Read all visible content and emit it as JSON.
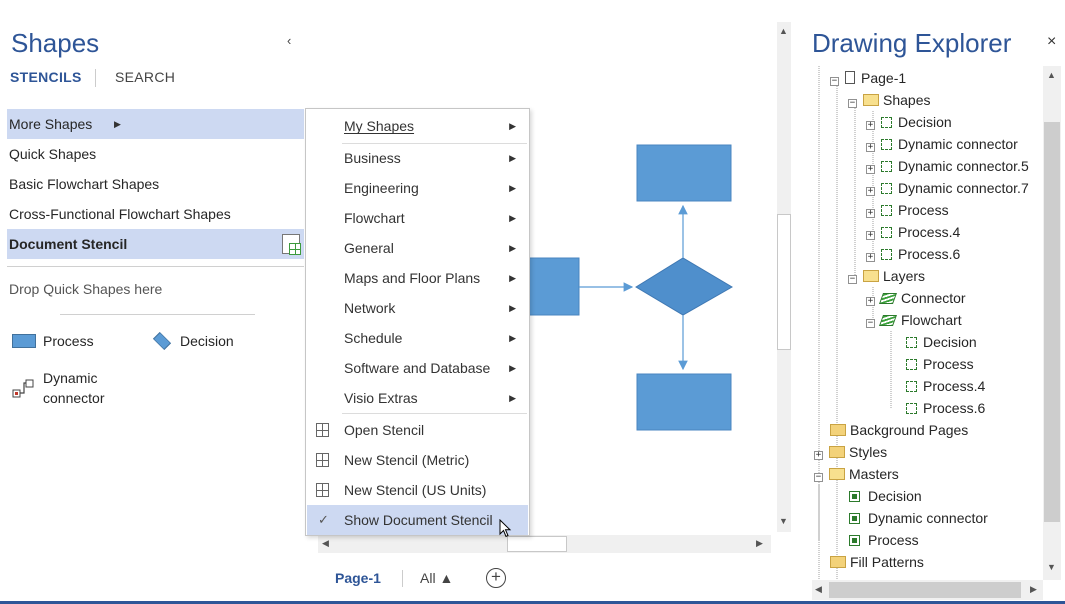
{
  "shapes_pane": {
    "title": "Shapes",
    "collapse_glyph": "‹",
    "tabs": {
      "stencils": "STENCILS",
      "search": "SEARCH"
    },
    "stencils": [
      {
        "label": "More Shapes",
        "highlighted": true,
        "has_submenu": true
      },
      {
        "label": "Quick Shapes"
      },
      {
        "label": "Basic Flowchart Shapes"
      },
      {
        "label": "Cross-Functional Flowchart Shapes"
      },
      {
        "label": "Document Stencil",
        "highlighted": true,
        "bold": true
      }
    ],
    "drop_text": "Drop Quick Shapes here",
    "masters": [
      {
        "label": "Process",
        "icon": "process-rect-icon"
      },
      {
        "label": "Decision",
        "icon": "decision-diamond-icon"
      },
      {
        "label": "Dynamic\nconnector",
        "line1": "Dynamic",
        "line2": "connector",
        "icon": "dynamic-connector-icon"
      }
    ]
  },
  "context_menu": {
    "groups": [
      [
        {
          "label": "My Shapes",
          "submenu": true
        }
      ],
      [
        {
          "label": "Business",
          "submenu": true
        },
        {
          "label": "Engineering",
          "submenu": true
        },
        {
          "label": "Flowchart",
          "submenu": true
        },
        {
          "label": "General",
          "submenu": true
        },
        {
          "label": "Maps and Floor Plans",
          "submenu": true
        },
        {
          "label": "Network",
          "submenu": true
        },
        {
          "label": "Schedule",
          "submenu": true
        },
        {
          "label": "Software and Database",
          "submenu": true
        },
        {
          "label": "Visio Extras",
          "submenu": true
        }
      ],
      [
        {
          "label": "Open Stencil",
          "icon": "open-stencil-icon"
        },
        {
          "label": "New Stencil (Metric)",
          "icon": "new-stencil-icon"
        },
        {
          "label": "New Stencil (US Units)",
          "icon": "new-stencil-icon"
        },
        {
          "label": "Show Document Stencil",
          "icon": "checkmark-icon",
          "checked": true
        }
      ]
    ],
    "submenu_glyph": "▶"
  },
  "canvas": {
    "colors": {
      "shape_fill": "#5b9bd5",
      "decision_fill": "#4f8fcc",
      "connector": "#5b9bd5"
    }
  },
  "page_tabs": {
    "active": "Page-1",
    "all": "All ▲",
    "add_glyph": "+"
  },
  "explorer": {
    "title": "Drawing Explorer",
    "close_glyph": "×",
    "tree": [
      {
        "label": "Page-1",
        "icon": "page-icon",
        "expander": "minus"
      },
      {
        "label": "Shapes",
        "icon": "folder-open-icon",
        "expander": "minus"
      },
      {
        "label": "Decision",
        "icon": "shape-icon",
        "expander": "plus"
      },
      {
        "label": "Dynamic connector",
        "icon": "shape-icon",
        "expander": "plus"
      },
      {
        "label": "Dynamic connector.5",
        "icon": "shape-icon",
        "expander": "plus"
      },
      {
        "label": "Dynamic connector.7",
        "icon": "shape-icon",
        "expander": "plus"
      },
      {
        "label": "Process",
        "icon": "shape-icon",
        "expander": "plus"
      },
      {
        "label": "Process.4",
        "icon": "shape-icon",
        "expander": "plus"
      },
      {
        "label": "Process.6",
        "icon": "shape-icon",
        "expander": "plus"
      },
      {
        "label": "Layers",
        "icon": "folder-open-icon",
        "expander": "minus"
      },
      {
        "label": "Connector",
        "icon": "layer-icon",
        "expander": "plus"
      },
      {
        "label": "Flowchart",
        "icon": "layer-icon",
        "expander": "minus"
      },
      {
        "label": "Decision",
        "icon": "shape-icon"
      },
      {
        "label": "Process",
        "icon": "shape-icon"
      },
      {
        "label": "Process.4",
        "icon": "shape-icon"
      },
      {
        "label": "Process.6",
        "icon": "shape-icon"
      },
      {
        "label": "Background Pages",
        "icon": "folder-icon"
      },
      {
        "label": "Styles",
        "icon": "folder-icon",
        "expander": "plus"
      },
      {
        "label": "Masters",
        "icon": "folder-open-icon",
        "expander": "minus"
      },
      {
        "label": "Decision",
        "icon": "master-icon"
      },
      {
        "label": "Dynamic connector",
        "icon": "master-icon"
      },
      {
        "label": "Process",
        "icon": "master-icon"
      },
      {
        "label": "Fill Patterns",
        "icon": "folder-icon"
      }
    ]
  }
}
